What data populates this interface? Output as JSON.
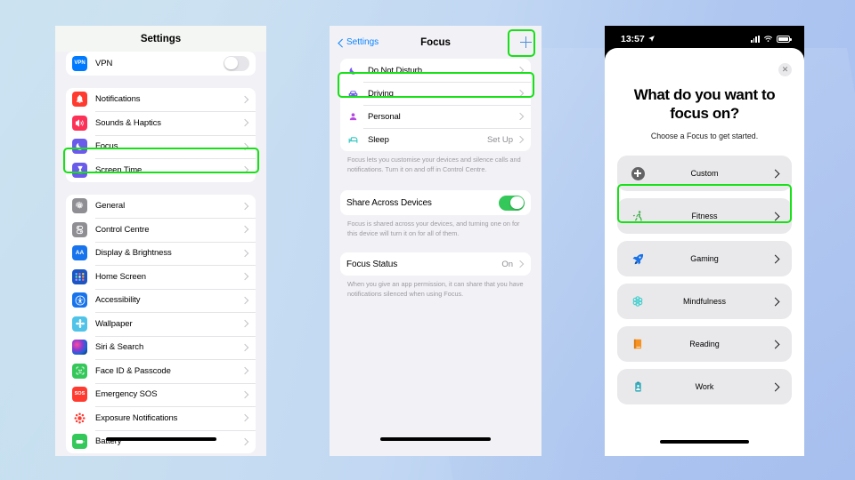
{
  "background": {
    "color_left": "#c3deef",
    "color_right": "#a8c0ef"
  },
  "highlight_color": "#16e016",
  "panel1": {
    "navbar": {
      "title": "Settings"
    },
    "group_vpn": [
      {
        "icon": "vpn-icon",
        "label": "VPN",
        "control": "toggle",
        "toggle_on": false
      }
    ],
    "group_alerts": [
      {
        "icon": "notifications-bell-icon",
        "label": "Notifications"
      },
      {
        "icon": "sounds-speaker-icon",
        "label": "Sounds & Haptics"
      },
      {
        "icon": "focus-moon-icon",
        "label": "Focus",
        "highlighted": true
      },
      {
        "icon": "screen-time-hourglass-icon",
        "label": "Screen Time"
      }
    ],
    "group_system": [
      {
        "icon": "general-gear-icon",
        "label": "General"
      },
      {
        "icon": "control-centre-icon",
        "label": "Control Centre"
      },
      {
        "icon": "display-brightness-icon",
        "label": "Display & Brightness"
      },
      {
        "icon": "home-screen-icon",
        "label": "Home Screen"
      },
      {
        "icon": "accessibility-icon",
        "label": "Accessibility"
      },
      {
        "icon": "wallpaper-icon",
        "label": "Wallpaper"
      },
      {
        "icon": "siri-search-icon",
        "label": "Siri & Search"
      },
      {
        "icon": "face-id-icon",
        "label": "Face ID & Passcode"
      },
      {
        "icon": "emergency-sos-icon",
        "label": "Emergency SOS"
      },
      {
        "icon": "exposure-notifications-icon",
        "label": "Exposure Notifications"
      },
      {
        "icon": "battery-icon",
        "label": "Battery"
      }
    ]
  },
  "panel2": {
    "navbar": {
      "back_label": "Settings",
      "title": "Focus",
      "add_label": "+"
    },
    "focus_list": [
      {
        "icon": "moon-icon",
        "label": "Do Not Disturb",
        "value": "",
        "highlighted": true
      },
      {
        "icon": "car-icon",
        "label": "Driving",
        "value": ""
      },
      {
        "icon": "person-icon",
        "label": "Personal",
        "value": ""
      },
      {
        "icon": "bed-icon",
        "label": "Sleep",
        "value": "Set Up"
      }
    ],
    "focus_footnote": "Focus lets you customise your devices and silence calls and notifications. Turn it on and off in Control Centre.",
    "share_row": {
      "label": "Share Across Devices",
      "toggle_on": true
    },
    "share_footnote": "Focus is shared across your devices, and turning one on for this device will turn it on for all of them.",
    "status_row": {
      "label": "Focus Status",
      "value": "On"
    },
    "status_footnote": "When you give an app permission, it can share that you have notifications silenced when using Focus."
  },
  "panel3": {
    "status_bar": {
      "time": "13:57",
      "location_icon": "location-arrow-icon"
    },
    "sheet": {
      "close_label": "✕",
      "title": "What do you want to focus on?",
      "subtitle": "Choose a Focus to get started."
    },
    "options": [
      {
        "icon": "custom-plus-icon",
        "label": "Custom",
        "highlighted": true
      },
      {
        "icon": "fitness-runner-icon",
        "label": "Fitness"
      },
      {
        "icon": "gaming-rocket-icon",
        "label": "Gaming"
      },
      {
        "icon": "mindfulness-flower-icon",
        "label": "Mindfulness"
      },
      {
        "icon": "reading-book-icon",
        "label": "Reading"
      },
      {
        "icon": "work-badge-icon",
        "label": "Work"
      }
    ]
  }
}
